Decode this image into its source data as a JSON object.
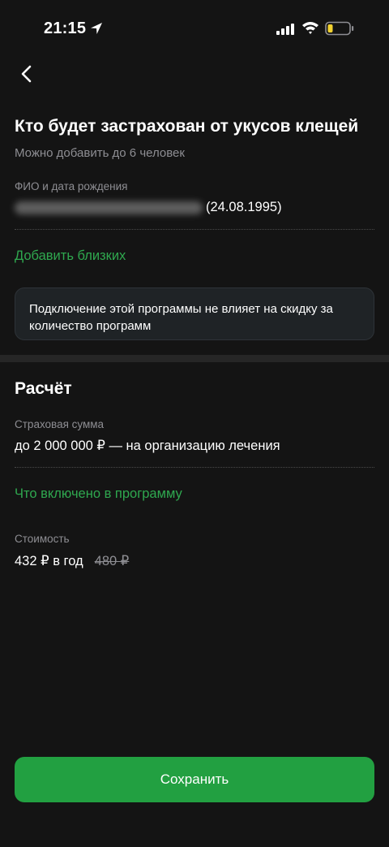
{
  "status_bar": {
    "time": "21:15"
  },
  "insured": {
    "title": "Кто будет застрахован от укусов клещей",
    "subtitle": "Можно добавить до 6 человек",
    "field_label": "ФИО и дата рождения",
    "birth_date": "(24.08.1995)",
    "add_link": "Добавить близких",
    "notice": "Подключение этой программы не влияет на скидку за количество программ"
  },
  "calculation": {
    "title": "Расчёт",
    "sum_label": "Страховая сумма",
    "sum_value": "до 2 000 000 ₽ — на организацию лечения",
    "program_link": "Что включено в программу",
    "cost_label": "Стоимость",
    "price": "432 ₽ в год",
    "old_price": "480 ₽"
  },
  "footer": {
    "save_label": "Сохранить"
  },
  "colors": {
    "accent": "#22a041",
    "background": "#141414"
  }
}
